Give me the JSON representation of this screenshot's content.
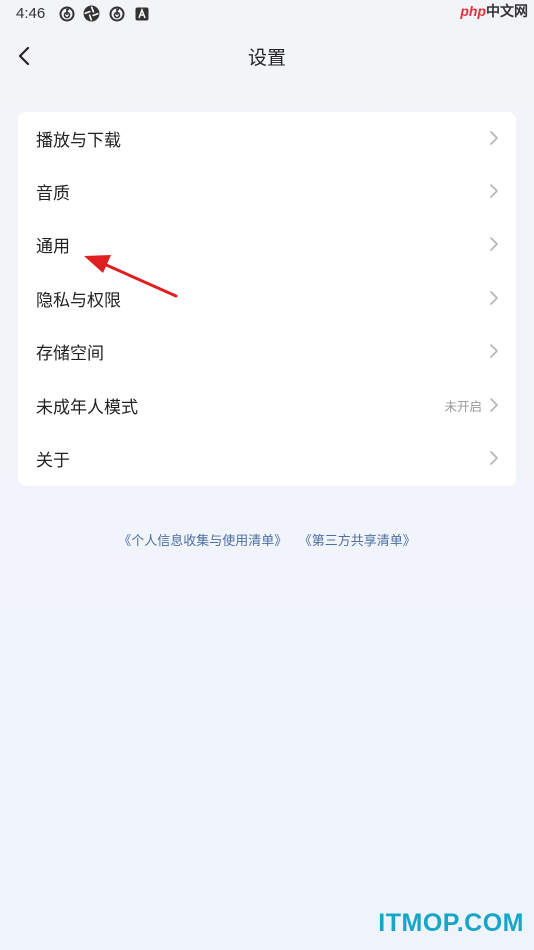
{
  "status_bar": {
    "time": "4:46",
    "icons": [
      "netease-music-icon",
      "aperture-icon",
      "netease-music-icon",
      "notification-a-icon"
    ]
  },
  "watermark_top": {
    "php": "php",
    "zh": "中文网"
  },
  "header": {
    "title": "设置",
    "back_icon": "chevron-left-icon"
  },
  "settings": {
    "items": [
      {
        "label": "播放与下载",
        "value": ""
      },
      {
        "label": "音质",
        "value": ""
      },
      {
        "label": "通用",
        "value": ""
      },
      {
        "label": "隐私与权限",
        "value": ""
      },
      {
        "label": "存储空间",
        "value": ""
      },
      {
        "label": "未成年人模式",
        "value": "未开启"
      },
      {
        "label": "关于",
        "value": ""
      }
    ]
  },
  "footer_links": {
    "personal_info": "《个人信息收集与使用清单》",
    "third_party": "《第三方共享清单》"
  },
  "watermark_bottom": "ITMOP.COM",
  "colors": {
    "background": "#f3f4f8",
    "card": "#ffffff",
    "link": "#4c6fa0",
    "annotation_arrow": "#e02020",
    "watermark": "#16a6c8"
  }
}
